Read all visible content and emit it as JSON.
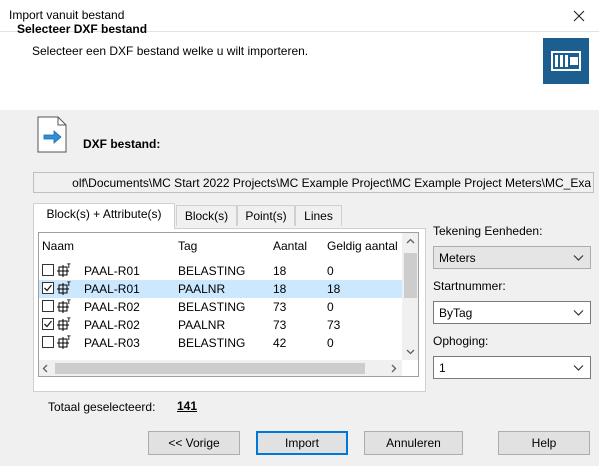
{
  "window": {
    "title": "Import vanuit bestand"
  },
  "header": {
    "title": "Selecteer DXF bestand",
    "subtitle": "Selecteer een DXF bestand welke u wilt importeren."
  },
  "file": {
    "label": "DXF bestand:",
    "path": "olf\\Documents\\MC Start 2022 Projects\\MC Example Project\\MC Example Project Meters\\MC_Exa"
  },
  "tabs": [
    {
      "label": "Block(s) + Attribute(s)",
      "active": true
    },
    {
      "label": "Block(s)",
      "active": false
    },
    {
      "label": "Point(s)",
      "active": false
    },
    {
      "label": "Lines",
      "active": false
    }
  ],
  "table": {
    "columns": [
      "Naam",
      "Tag",
      "Aantal",
      "Geldig aantal"
    ],
    "rows": [
      {
        "checked": false,
        "selected": false,
        "naam": "PAAL-R01",
        "tag": "BELASTING",
        "aantal": "18",
        "geldig": "0"
      },
      {
        "checked": true,
        "selected": true,
        "naam": "PAAL-R01",
        "tag": "PAALNR",
        "aantal": "18",
        "geldig": "18"
      },
      {
        "checked": false,
        "selected": false,
        "naam": "PAAL-R02",
        "tag": "BELASTING",
        "aantal": "73",
        "geldig": "0"
      },
      {
        "checked": true,
        "selected": false,
        "naam": "PAAL-R02",
        "tag": "PAALNR",
        "aantal": "73",
        "geldig": "73"
      },
      {
        "checked": false,
        "selected": false,
        "naam": "PAAL-R03",
        "tag": "BELASTING",
        "aantal": "42",
        "geldig": "0"
      }
    ],
    "block_icon_superscript": "T"
  },
  "settings": {
    "units_label": "Tekening Eenheden:",
    "units_value": "Meters",
    "start_label": "Startnummer:",
    "start_value": "ByTag",
    "increment_label": "Ophoging:",
    "increment_value": "1"
  },
  "summary": {
    "label": "Totaal geselecteerd:",
    "value": "141"
  },
  "buttons": {
    "back": "<< Vorige",
    "import": "Import",
    "cancel": "Annuleren",
    "help": "Help"
  },
  "colors": {
    "accent": "#0078d7",
    "logo_bg": "#1d5e91",
    "selection": "#cce8ff"
  },
  "icons": [
    "close-icon",
    "file-arrow-icon",
    "dxf-logo-icon",
    "checkbox-icon",
    "block-attribute-icon",
    "chevron-down-icon",
    "scroll-arrow-icon"
  ]
}
